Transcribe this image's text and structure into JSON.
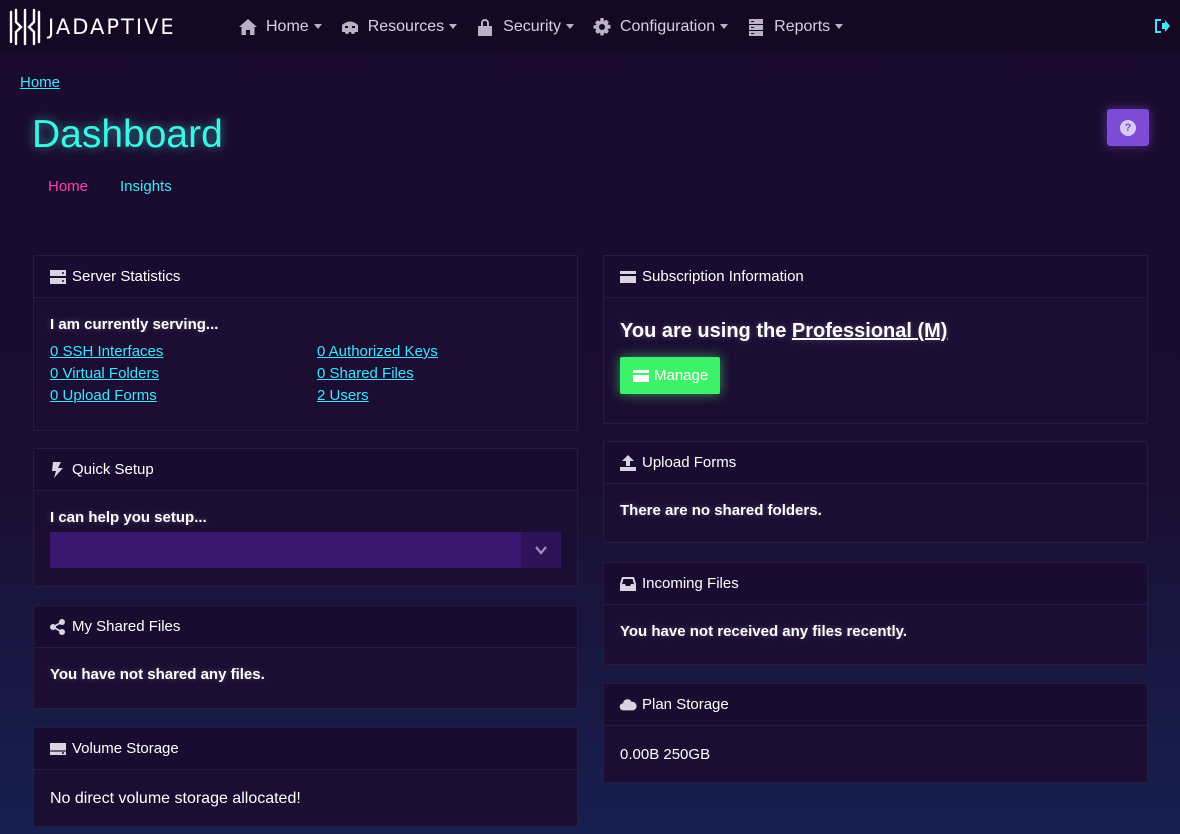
{
  "brand": {
    "name": "JADAPTIVE"
  },
  "nav": {
    "items": [
      {
        "label": "Home",
        "icon": "home-icon"
      },
      {
        "label": "Resources",
        "icon": "truck-icon"
      },
      {
        "label": "Security",
        "icon": "lock-icon"
      },
      {
        "label": "Configuration",
        "icon": "gear-icon"
      },
      {
        "label": "Reports",
        "icon": "server-icon"
      }
    ],
    "logout_icon": "sign-out-icon"
  },
  "breadcrumb": {
    "home": "Home"
  },
  "page": {
    "title": "Dashboard",
    "help_label": "?",
    "tabs": [
      {
        "label": "Home",
        "active": true
      },
      {
        "label": "Insights",
        "active": false
      }
    ]
  },
  "server_statistics": {
    "title": "Server Statistics",
    "intro": "I am currently serving...",
    "links": [
      "0 SSH Interfaces",
      "0 Authorized Keys",
      "0 Virtual Folders",
      "0 Shared Files",
      "0 Upload Forms",
      "2 Users"
    ]
  },
  "quick_setup": {
    "title": "Quick Setup",
    "intro": "I can help you setup...",
    "selected": ""
  },
  "my_shared_files": {
    "title": "My Shared Files",
    "message": "You have not shared any files."
  },
  "volume_storage": {
    "title": "Volume Storage",
    "message": "No direct volume storage allocated!"
  },
  "subscription": {
    "title": "Subscription Information",
    "prefix": "You are using the",
    "plan": "Professional (M)",
    "manage_label": "Manage"
  },
  "upload_forms": {
    "title": "Upload Forms",
    "message": "There are no shared folders."
  },
  "incoming_files": {
    "title": "Incoming Files",
    "message": "You have not received any files recently."
  },
  "plan_storage": {
    "title": "Plan Storage",
    "used": "0.00B",
    "total": "250GB"
  },
  "colors": {
    "accent_cyan": "#3de5ff",
    "title_teal": "#3df5e5",
    "active_tab_pink": "#ff3fb4",
    "help_purple": "#7e4bd6",
    "manage_green": "#3df26a"
  }
}
